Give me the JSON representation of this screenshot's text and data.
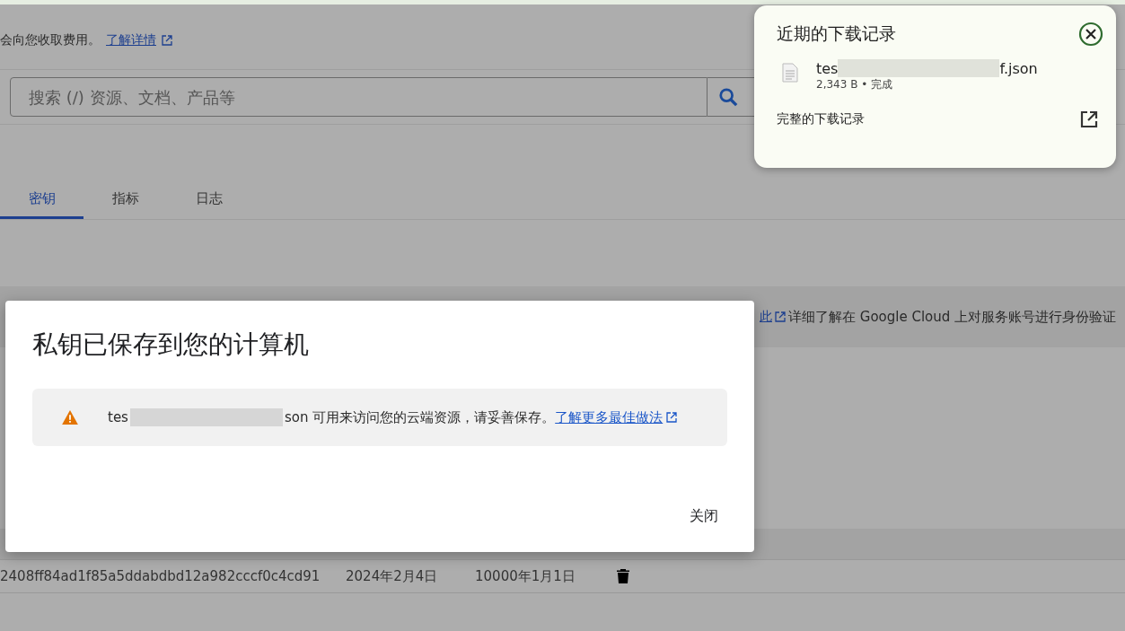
{
  "notice": {
    "text": "会向您收取费用。",
    "link": "了解详情"
  },
  "search": {
    "placeholder": "搜索 (/) 资源、文档、产品等"
  },
  "tabs": [
    {
      "label": "密钥",
      "selected": true
    },
    {
      "label": "指标",
      "selected": false
    },
    {
      "label": "日志",
      "selected": false
    }
  ],
  "info": {
    "link": "此",
    "text": "详细了解在 Google Cloud 上对服务账号进行身份验证"
  },
  "keys_table": {
    "rows": [
      {
        "key_id": "2408ff84ad1f85a5ddabdbd12a982cccf0c4cd91",
        "created": "2024年2月4日",
        "expires": "10000年1月1日"
      }
    ]
  },
  "dialog": {
    "title": "私钥已保存到您的计算机",
    "warning": {
      "file_start": "tes",
      "text": "son 可用来访问您的云端资源，请妥善保存。",
      "link": "了解更多最佳做法"
    },
    "close_button": "关闭"
  },
  "downloads": {
    "title": "近期的下载记录",
    "items": [
      {
        "name_start": "tes",
        "name_end": "f.json",
        "status": "2,343 B • 完成"
      }
    ],
    "full_history": "完整的下载记录"
  }
}
